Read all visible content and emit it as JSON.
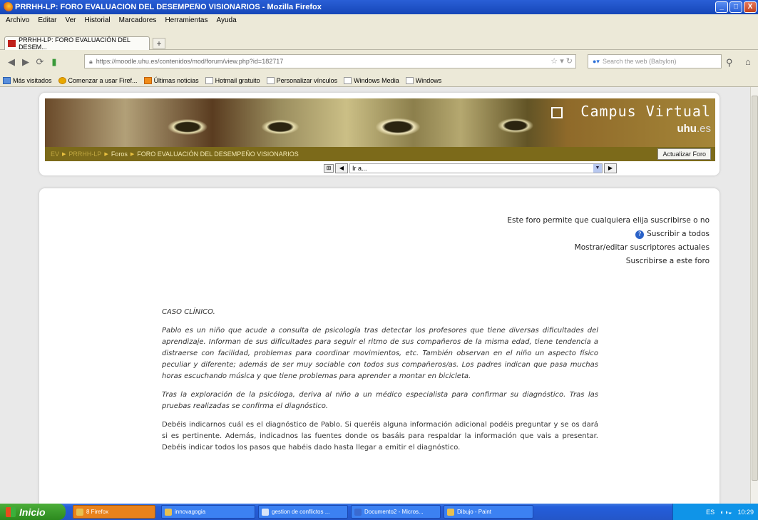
{
  "window": {
    "title": "PRRHH-LP: FORO EVALUACIÓN DEL DESEMPEÑO VISIONARIOS - Mozilla Firefox",
    "min": "_",
    "max": "□",
    "close": "X"
  },
  "menu": [
    "Archivo",
    "Editar",
    "Ver",
    "Historial",
    "Marcadores",
    "Herramientas",
    "Ayuda"
  ],
  "tab": {
    "label": "PRRHH-LP: FORO EVALUACIÓN DEL DESEM...",
    "new_tab": "+"
  },
  "nav": {
    "url": "https://moodle.uhu.es/contenidos/mod/forum/view.php?id=182717",
    "search_placeholder": "Search the web (Babylon)"
  },
  "bookmarks": [
    "Más visitados",
    "Comenzar a usar Firef...",
    "Últimas noticias",
    "Hotmail gratuito",
    "Personalizar vínculos",
    "Windows Media",
    "Windows"
  ],
  "header": {
    "brand": "Campus Virtual",
    "brand_sub": "uhu",
    "brand_ext": ".es",
    "breadcrumb": [
      "EV",
      "PRRHH-LP",
      "Foros",
      "FORO EVALUACIÓN DEL DESEMPEÑO VISIONARIOS"
    ],
    "update_button": "Actualizar Foro",
    "jump_placeholder": "Ir a..."
  },
  "subscription": {
    "info": "Este foro permite que cualquiera elija suscribirse o no",
    "subscribe_all": "Suscribir a todos",
    "show_edit": "Mostrar/editar suscriptores actuales",
    "subscribe_this": "Suscribirse a este foro"
  },
  "post": {
    "heading": "CASO CLÍNICO.",
    "p1": "Pablo es un niño que acude a consulta de psicología tras detectar los profesores que tiene diversas dificultades del aprendizaje. Informan de sus dificultades para seguir el ritmo de sus compañeros de la misma edad, tiene tendencia a distraerse con facilidad, problemas para coordinar movimientos, etc. También observan en el niño un aspecto físico peculiar y diferente; además de ser muy sociable con todos sus compañeros/as. Los padres indican que pasa muchas horas escuchando música y que tiene problemas para aprender a montar en bicicleta.",
    "p2": "Tras la exploración de la psicóloga, deriva al niño a un médico especialista para confirmar su diagnóstico. Tras las pruebas realizadas se confirma el diagnóstico.",
    "p3": "Debéis indicarnos cuál es el diagnóstico de Pablo. Si queréis alguna información adicional podéis preguntar y se os dará si es pertinente. Además, indicadnos las fuentes donde os basáis para respaldar la información que vais a presentar. Debéis indicar todos los pasos que habéis dado hasta llegar a emitir el diagnóstico."
  },
  "taskbar": {
    "start": "Inicio",
    "tasks": [
      "8 Firefox",
      "innovagogia",
      "gestion de conflictos ...",
      "Documento2 - Micros...",
      "Dibujo - Paint"
    ],
    "lang": "ES",
    "time": "10:29"
  }
}
